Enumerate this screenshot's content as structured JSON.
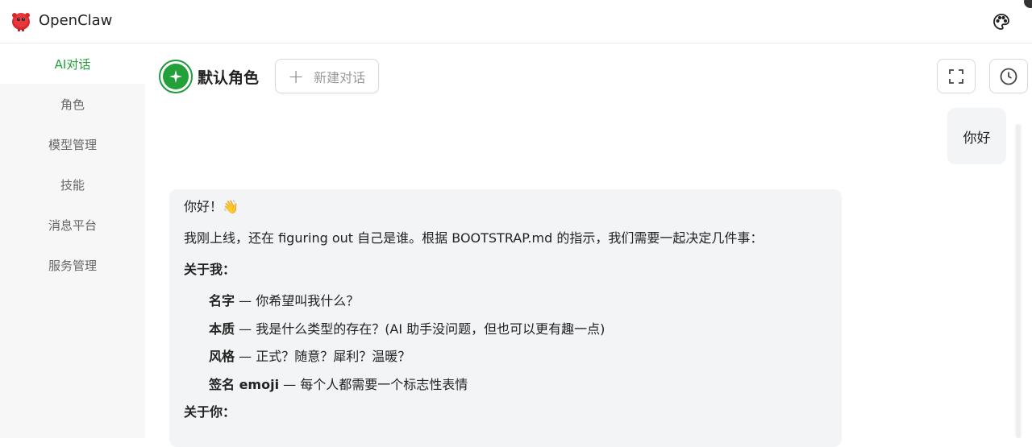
{
  "app": {
    "title": "OpenClaw",
    "logo_icon": "red-mascot-logo",
    "brand_color": "#23a03a"
  },
  "topbar": {
    "palette_icon": "palette-icon"
  },
  "sidebar": {
    "items": [
      {
        "label": "AI对话",
        "active": true
      },
      {
        "label": "角色",
        "active": false
      },
      {
        "label": "模型管理",
        "active": false
      },
      {
        "label": "技能",
        "active": false
      },
      {
        "label": "消息平台",
        "active": false
      },
      {
        "label": "服务管理",
        "active": false
      }
    ]
  },
  "chat_header": {
    "role_name": "默认角色",
    "new_chat_label": "新建对话",
    "fullscreen_icon": "fullscreen-icon",
    "history_icon": "clock-icon"
  },
  "messages": {
    "user": {
      "text": "你好"
    },
    "assistant": {
      "greeting": "你好！👋",
      "intro": "我刚上线，还在 figuring out 自己是谁。根据 BOOTSTRAP.md 的指示，我们需要一起决定几件事：",
      "about_me_heading": "关于我：",
      "about_me_items": [
        {
          "term": "名字",
          "desc": " — 你希望叫我什么？"
        },
        {
          "term": "本质",
          "desc": " — 我是什么类型的存在？(AI 助手没问题，但也可以更有趣一点)"
        },
        {
          "term": "风格",
          "desc": " — 正式？随意？犀利？温暖？"
        },
        {
          "term": "签名 emoji",
          "desc": " — 每个人都需要一个标志性表情"
        }
      ],
      "about_you_heading": "关于你："
    }
  }
}
